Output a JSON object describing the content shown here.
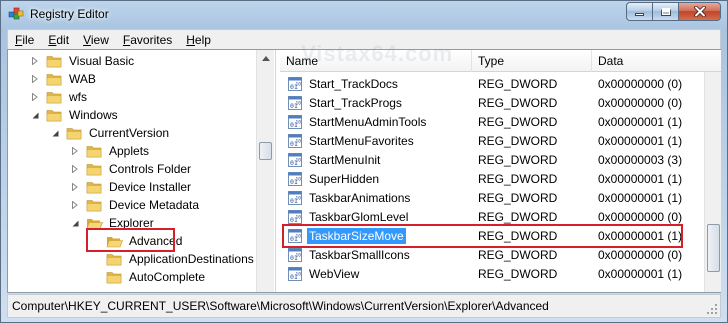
{
  "window": {
    "title": "Registry Editor",
    "watermark": "Vistax64.com",
    "accent_color": "#d5202b",
    "selection_color": "#3399ff"
  },
  "menu": {
    "items": [
      {
        "label": "File",
        "mnemonic": "F",
        "rest": "ile"
      },
      {
        "label": "Edit",
        "mnemonic": "E",
        "rest": "dit"
      },
      {
        "label": "View",
        "mnemonic": "V",
        "rest": "iew"
      },
      {
        "label": "Favorites",
        "mnemonic": "F",
        "rest": "avorites"
      },
      {
        "label": "Help",
        "mnemonic": "H",
        "rest": "elp"
      }
    ]
  },
  "tree": {
    "items": [
      {
        "label": "Visual Basic",
        "expander": "collapsed",
        "icon": "folder-icon"
      },
      {
        "label": "WAB",
        "expander": "collapsed",
        "icon": "folder-icon"
      },
      {
        "label": "wfs",
        "expander": "collapsed",
        "icon": "folder-icon"
      },
      {
        "label": "Windows",
        "expander": "expanded",
        "icon": "folder-icon"
      },
      {
        "label": "CurrentVersion",
        "expander": "expanded",
        "icon": "folder-icon"
      },
      {
        "label": "Applets",
        "expander": "collapsed",
        "icon": "folder-icon"
      },
      {
        "label": "Controls Folder",
        "expander": "collapsed",
        "icon": "folder-icon"
      },
      {
        "label": "Device Installer",
        "expander": "collapsed",
        "icon": "folder-icon"
      },
      {
        "label": "Device Metadata",
        "expander": "collapsed",
        "icon": "folder-icon"
      },
      {
        "label": "Explorer",
        "expander": "expanded",
        "icon": "folder-open-icon"
      },
      {
        "label": "Advanced",
        "expander": "none",
        "icon": "folder-open-icon",
        "selected": true
      },
      {
        "label": "ApplicationDestinations",
        "expander": "none",
        "icon": "folder-icon"
      },
      {
        "label": "AutoComplete",
        "expander": "none",
        "icon": "folder-icon"
      }
    ]
  },
  "list": {
    "columns": [
      "Name",
      "Type",
      "Data"
    ],
    "rows": [
      {
        "name": "Start_TrackDocs",
        "type": "REG_DWORD",
        "data": "0x00000000 (0)"
      },
      {
        "name": "Start_TrackProgs",
        "type": "REG_DWORD",
        "data": "0x00000000 (0)"
      },
      {
        "name": "StartMenuAdminTools",
        "type": "REG_DWORD",
        "data": "0x00000001 (1)"
      },
      {
        "name": "StartMenuFavorites",
        "type": "REG_DWORD",
        "data": "0x00000001 (1)"
      },
      {
        "name": "StartMenuInit",
        "type": "REG_DWORD",
        "data": "0x00000003 (3)"
      },
      {
        "name": "SuperHidden",
        "type": "REG_DWORD",
        "data": "0x00000001 (1)"
      },
      {
        "name": "TaskbarAnimations",
        "type": "REG_DWORD",
        "data": "0x00000001 (1)"
      },
      {
        "name": "TaskbarGlomLevel",
        "type": "REG_DWORD",
        "data": "0x00000000 (0)"
      },
      {
        "name": "TaskbarSizeMove",
        "type": "REG_DWORD",
        "data": "0x00000001 (1)",
        "selected": true
      },
      {
        "name": "TaskbarSmallIcons",
        "type": "REG_DWORD",
        "data": "0x00000000 (0)"
      },
      {
        "name": "WebView",
        "type": "REG_DWORD",
        "data": "0x00000001 (1)"
      }
    ]
  },
  "statusbar": {
    "path": "Computer\\HKEY_CURRENT_USER\\Software\\Microsoft\\Windows\\CurrentVersion\\Explorer\\Advanced"
  }
}
